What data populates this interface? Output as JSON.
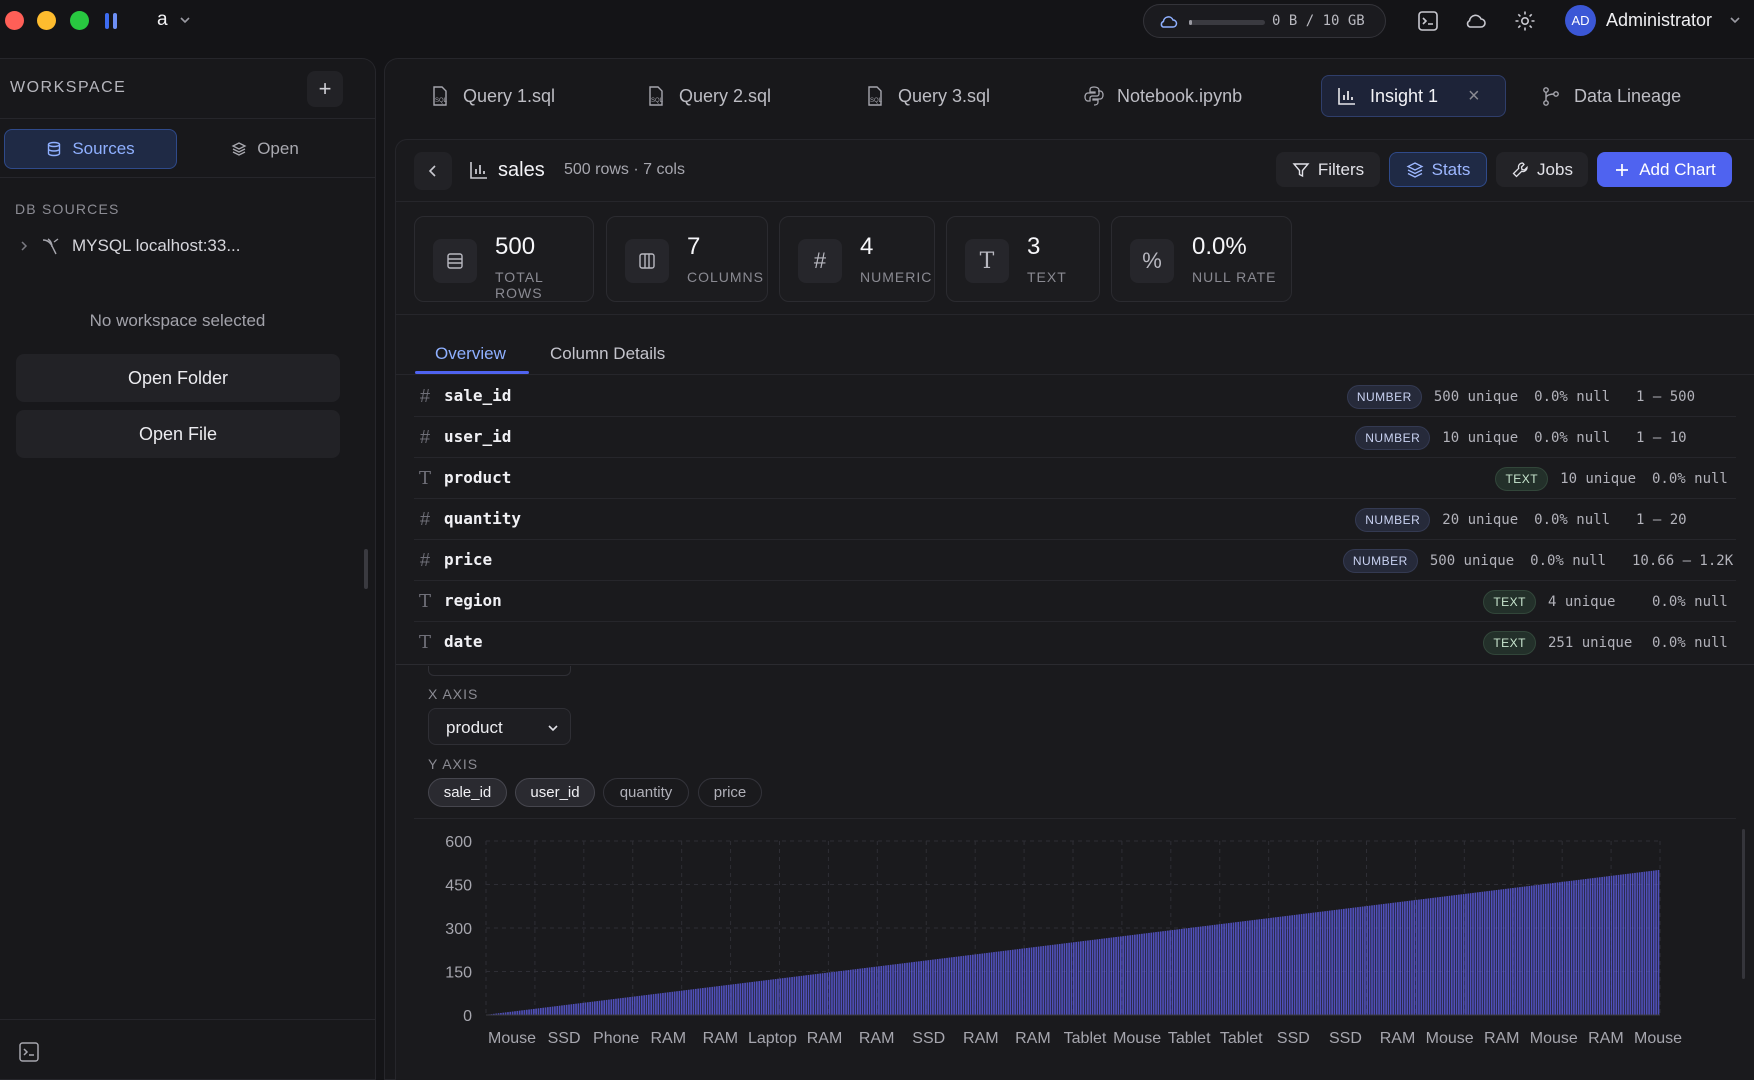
{
  "titlebar": {
    "workspace_name": "a",
    "storage_text": "0 B / 10 GB",
    "storage_fraction": 0.0,
    "user_initials": "AD",
    "user_name": "Administrator"
  },
  "sidebar": {
    "title": "WORKSPACE",
    "add_label": "+",
    "tabs": [
      {
        "label": "Sources"
      },
      {
        "label": "Open"
      }
    ],
    "db_sources_title": "DB SOURCES",
    "db_item": "MYSQL localhost:33...",
    "empty_message": "No workspace selected",
    "open_folder": "Open Folder",
    "open_file": "Open File"
  },
  "tabs": [
    {
      "label": "Query 1.sql",
      "icon": "sql-file-icon"
    },
    {
      "label": "Query 2.sql",
      "icon": "sql-file-icon"
    },
    {
      "label": "Query 3.sql",
      "icon": "sql-file-icon"
    },
    {
      "label": "Notebook.ipynb",
      "icon": "python-icon"
    },
    {
      "label": "Insight 1",
      "icon": "bar-chart-icon",
      "close": "×"
    },
    {
      "label": "Data Lineage",
      "icon": "lineage-icon"
    }
  ],
  "header": {
    "title": "sales",
    "meta": "500 rows · 7 cols",
    "filters": "Filters",
    "stats": "Stats",
    "jobs": "Jobs",
    "add_chart": "Add Chart"
  },
  "stats": [
    {
      "value": "500",
      "label": "TOTAL ROWS",
      "icon": "rows-icon"
    },
    {
      "value": "7",
      "label": "COLUMNS",
      "icon": "columns-icon"
    },
    {
      "value": "4",
      "label": "NUMERIC",
      "icon": "hash-icon"
    },
    {
      "value": "3",
      "label": "TEXT",
      "icon": "text-icon"
    },
    {
      "value": "0.0%",
      "label": "NULL RATE",
      "icon": "percent-icon"
    }
  ],
  "subtabs": [
    "Overview",
    "Column Details"
  ],
  "columns": [
    {
      "icon": "#",
      "name": "sale_id",
      "type": "NUMBER",
      "unique": "500 unique",
      "null": "0.0% null",
      "range": "1 – 500"
    },
    {
      "icon": "#",
      "name": "user_id",
      "type": "NUMBER",
      "unique": "10 unique",
      "null": "0.0% null",
      "range": "1 – 10"
    },
    {
      "icon": "T",
      "name": "product",
      "type": "TEXT",
      "unique": "10 unique",
      "null": "0.0% null",
      "range": ""
    },
    {
      "icon": "#",
      "name": "quantity",
      "type": "NUMBER",
      "unique": "20 unique",
      "null": "0.0% null",
      "range": "1 – 20"
    },
    {
      "icon": "#",
      "name": "price",
      "type": "NUMBER",
      "unique": "500 unique",
      "null": "0.0% null",
      "range": "10.66 – 1.2K"
    },
    {
      "icon": "T",
      "name": "region",
      "type": "TEXT",
      "unique": "4 unique",
      "null": "0.0% null",
      "range": ""
    },
    {
      "icon": "T",
      "name": "date",
      "type": "TEXT",
      "unique": "251 unique",
      "null": "0.0% null",
      "range": ""
    }
  ],
  "chart_config": {
    "x_axis_label": "X AXIS",
    "x_axis_value": "product",
    "y_axis_label": "Y AXIS",
    "y_chips": [
      {
        "label": "sale_id",
        "on": true
      },
      {
        "label": "user_id",
        "on": true
      },
      {
        "label": "quantity",
        "on": false
      },
      {
        "label": "price",
        "on": false
      }
    ]
  },
  "chart_data": {
    "type": "bar",
    "xlabel": "",
    "ylabel": "",
    "ylim": [
      0,
      600
    ],
    "yticks": [
      "0",
      "150",
      "300",
      "450",
      "600"
    ],
    "x_tick_labels": [
      "Mouse",
      "SSD",
      "Phone",
      "RAM",
      "RAM",
      "Laptop",
      "RAM",
      "RAM",
      "SSD",
      "RAM",
      "RAM",
      "Tablet",
      "Mouse",
      "Tablet",
      "Tablet",
      "SSD",
      "SSD",
      "RAM",
      "Mouse",
      "RAM",
      "Mouse",
      "RAM",
      "Mouse"
    ],
    "series": [
      {
        "values_description": "sale_id from 1 to 500, one bar per row",
        "start": 1,
        "end": 500,
        "count": 500
      },
      {
        "start": 1,
        "end": 10,
        "count": 500
      }
    ],
    "grid": true,
    "colors": {
      "bar": "#5b5bd6",
      "grid": "#2e2e35"
    }
  }
}
